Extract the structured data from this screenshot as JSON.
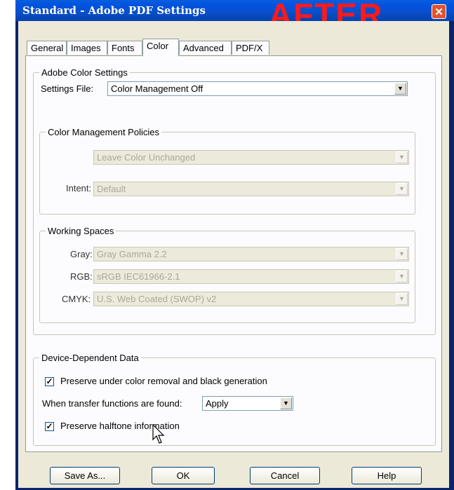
{
  "window": {
    "title": "Standard - Adobe PDF Settings",
    "overlay_label": "AFTER",
    "close_glyph": "✕"
  },
  "tabs": [
    {
      "label": "General",
      "active": false
    },
    {
      "label": "Images",
      "active": false
    },
    {
      "label": "Fonts",
      "active": false
    },
    {
      "label": "Color",
      "active": true
    },
    {
      "label": "Advanced",
      "active": false
    },
    {
      "label": "PDF/X",
      "active": false
    }
  ],
  "color_settings": {
    "group_title": "Adobe Color Settings",
    "settings_file_label": "Settings File:",
    "settings_file_value": "Color Management Off"
  },
  "policies": {
    "group_title": "Color Management Policies",
    "policy_value": "Leave Color Unchanged",
    "intent_label": "Intent:",
    "intent_value": "Default"
  },
  "working_spaces": {
    "group_title": "Working Spaces",
    "gray_label": "Gray:",
    "gray_value": "Gray Gamma 2.2",
    "rgb_label": "RGB:",
    "rgb_value": "sRGB IEC61966-2.1",
    "cmyk_label": "CMYK:",
    "cmyk_value": "U.S. Web Coated (SWOP) v2"
  },
  "device_data": {
    "group_title": "Device-Dependent Data",
    "preserve_ucr_label": "Preserve under color removal and black generation",
    "preserve_ucr_checked": true,
    "transfer_label": "When transfer functions are found:",
    "transfer_value": "Apply",
    "preserve_halftone_label": "Preserve halftone information",
    "preserve_halftone_checked": true
  },
  "buttons": {
    "save_as": "Save As...",
    "ok": "OK",
    "cancel": "Cancel",
    "help": "Help"
  },
  "glyphs": {
    "dropdown_arrow": "▼",
    "check": "✓"
  }
}
